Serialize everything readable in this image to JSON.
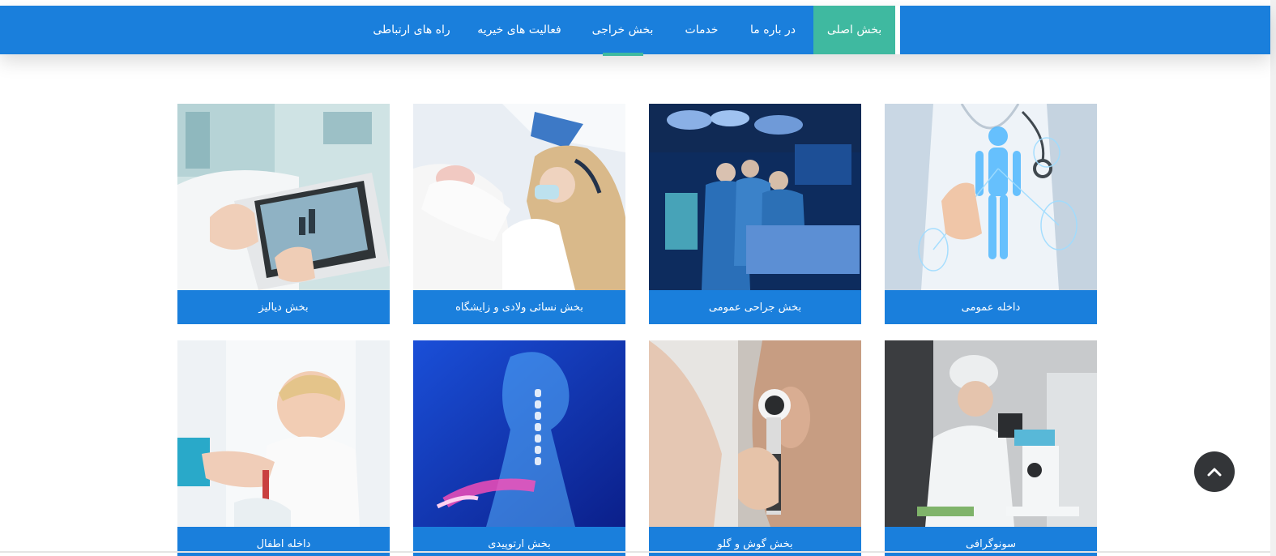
{
  "nav": {
    "items": [
      {
        "label": "بخش اصلی",
        "active": true
      },
      {
        "label": "در باره ما"
      },
      {
        "label": "خدمات"
      },
      {
        "label": "بخش خراجی",
        "underlined": true
      },
      {
        "label": "فعالیت های خیریه"
      },
      {
        "label": "راه های ارتباطی"
      }
    ],
    "colors": {
      "bar": "#1a7fdc",
      "active": "#3fb9a0"
    }
  },
  "departments": [
    {
      "title": "داخله عمومی",
      "image": "doctor-holographic-body"
    },
    {
      "title": "بخش جراحی عمومی",
      "image": "surgery-team"
    },
    {
      "title": "بخش نسائی ولادی و زایشگاه",
      "image": "nurse-with-newborn"
    },
    {
      "title": "بخش دیالیز",
      "image": "dialysis-monitor"
    },
    {
      "title": "سونوگرافی",
      "image": "lab-microscope"
    },
    {
      "title": "بخش گوش و گلو",
      "image": "ear-examination"
    },
    {
      "title": "بخش ارتوپیدی",
      "image": "skeleton-xray"
    },
    {
      "title": "داخله اطفال",
      "image": "child-vaccination"
    }
  ],
  "scroll_top": {
    "icon": "chevron-up-icon"
  }
}
